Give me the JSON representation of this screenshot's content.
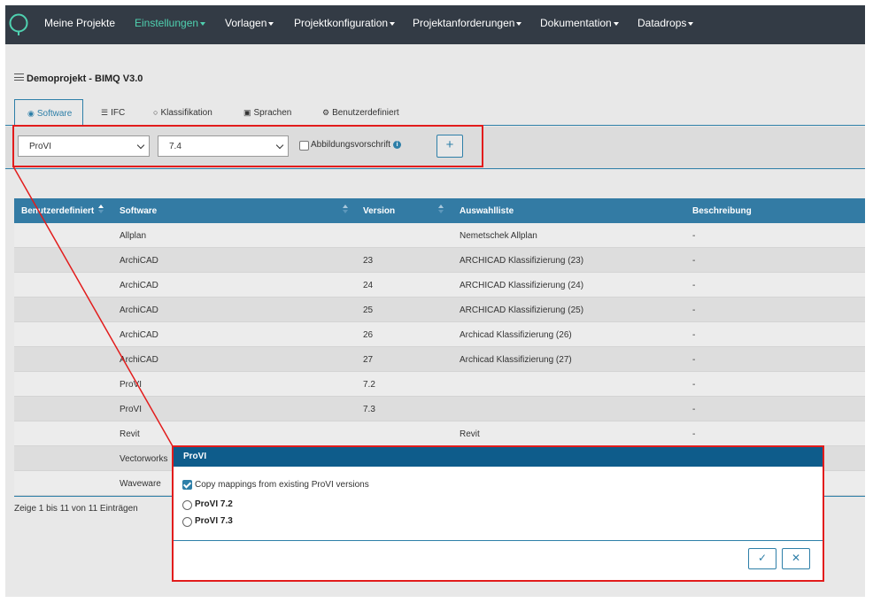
{
  "nav": {
    "items": [
      {
        "label": "Meine Projekte",
        "dropdown": false
      },
      {
        "label": "Einstellungen",
        "dropdown": true,
        "active": true
      },
      {
        "label": "Vorlagen",
        "dropdown": true
      },
      {
        "label": "Projektkonfiguration",
        "dropdown": true
      },
      {
        "label": "Projektanforderungen",
        "dropdown": true
      },
      {
        "label": "Dokumentation",
        "dropdown": true
      },
      {
        "label": "Datadrops",
        "dropdown": true
      }
    ],
    "colors": {
      "background": "#333b45",
      "active": "#4fd1b0",
      "logo": "#4fd1b0"
    }
  },
  "project": {
    "title": "Demoprojekt - BIMQ V3.0"
  },
  "tabs": [
    {
      "label": "Software",
      "icon": "software-icon",
      "active": true
    },
    {
      "label": "IFC",
      "icon": "ifc-icon"
    },
    {
      "label": "Klassifikation",
      "icon": "classification-icon"
    },
    {
      "label": "Sprachen",
      "icon": "language-icon"
    },
    {
      "label": "Benutzerdefiniert",
      "icon": "custom-icon"
    }
  ],
  "toolbar": {
    "software_value": "ProVI",
    "version_value": "7.4",
    "mapping_label": "Abbildungsvorschrift",
    "add_label": "+"
  },
  "table": {
    "columns": [
      "Benutzerdefiniert",
      "Software",
      "Version",
      "Auswahlliste",
      "Beschreibung"
    ],
    "rows": [
      {
        "custom": "",
        "software": "Allplan",
        "version": "",
        "list": "Nemetschek Allplan",
        "desc": "-"
      },
      {
        "custom": "",
        "software": "ArchiCAD",
        "version": "23",
        "list": "ARCHICAD Klassifizierung (23)",
        "desc": "-"
      },
      {
        "custom": "",
        "software": "ArchiCAD",
        "version": "24",
        "list": "ARCHICAD Klassifizierung (24)",
        "desc": "-"
      },
      {
        "custom": "",
        "software": "ArchiCAD",
        "version": "25",
        "list": "ARCHICAD Klassifizierung (25)",
        "desc": "-"
      },
      {
        "custom": "",
        "software": "ArchiCAD",
        "version": "26",
        "list": "Archicad Klassifizierung (26)",
        "desc": "-"
      },
      {
        "custom": "",
        "software": "ArchiCAD",
        "version": "27",
        "list": "Archicad Klassifizierung (27)",
        "desc": "-"
      },
      {
        "custom": "",
        "software": "ProVI",
        "version": "7.2",
        "list": "",
        "desc": "-"
      },
      {
        "custom": "",
        "software": "ProVI",
        "version": "7.3",
        "list": "",
        "desc": "-"
      },
      {
        "custom": "",
        "software": "Revit",
        "version": "",
        "list": "Revit",
        "desc": "-"
      },
      {
        "custom": "",
        "software": "Vectorworks",
        "version": "",
        "list": "",
        "desc": ""
      },
      {
        "custom": "",
        "software": "Waveware",
        "version": "",
        "list": "",
        "desc": ""
      }
    ],
    "info": "Zeige 1 bis 11 von 11 Einträgen",
    "header_color": "#337ba4"
  },
  "modal": {
    "title": "ProVI",
    "copy_label": "Copy mappings from existing ProVI versions",
    "copy_checked": true,
    "options": [
      {
        "label": "ProVI 7.2",
        "selected": false
      },
      {
        "label": "ProVI 7.3",
        "selected": false
      }
    ],
    "confirm_icon": "check-icon",
    "cancel_icon": "close-icon",
    "confirm_label": "✓",
    "cancel_label": "✕",
    "header_color": "#0e5c8b"
  },
  "annotation": {
    "color": "#e21c1c"
  }
}
